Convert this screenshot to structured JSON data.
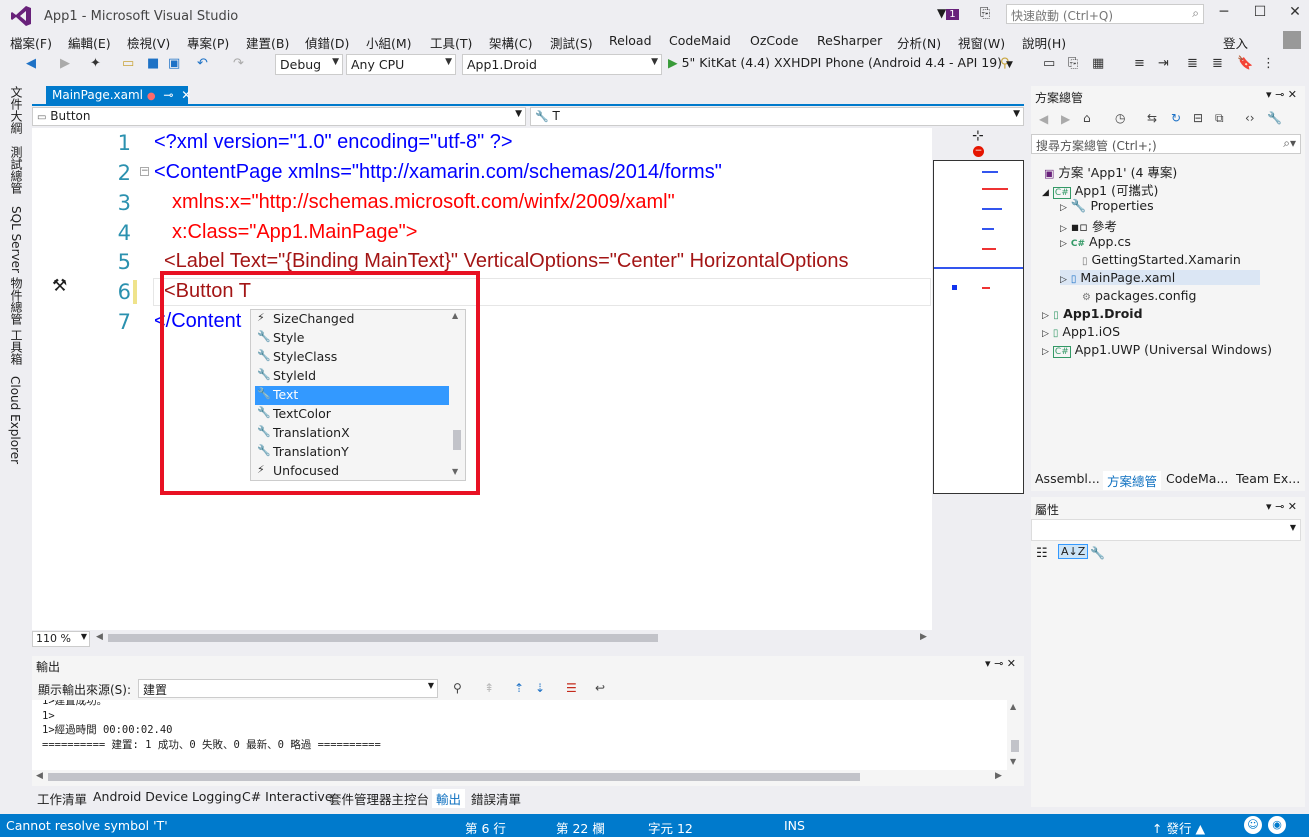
{
  "window": {
    "title": "App1 - Microsoft Visual Studio",
    "notification_count": "1",
    "quick_launch_placeholder": "快速啟動 (Ctrl+Q)",
    "accent": "#007acc"
  },
  "menu": [
    "檔案(F)",
    "編輯(E)",
    "檢視(V)",
    "專案(P)",
    "建置(B)",
    "偵錯(D)",
    "小組(M)",
    "工具(T)",
    "架構(C)",
    "測試(S)",
    "Reload",
    "CodeMaid",
    "OzCode",
    "ReSharper",
    "分析(N)",
    "視窗(W)",
    "說明(H)"
  ],
  "signin": "登入",
  "toolbar": {
    "config": "Debug",
    "platform": "Any CPU",
    "startup": "App1.Droid",
    "run_target": "5\" KitKat (4.4) XXHDPI Phone (Android 4.4 - API 19)"
  },
  "left_rail": [
    "文件大綱",
    "測試總管",
    "SQL Server 物件總管",
    "工具箱",
    "Cloud Explorer"
  ],
  "document_tab": {
    "name": "MainPage.xaml",
    "modified": "●",
    "pin": "⊸",
    "close": "✕"
  },
  "nav": {
    "left": "Button",
    "right": "T"
  },
  "code_lines": [
    {
      "num": "1",
      "text": "<?xml version=\"1.0\" encoding=\"utf-8\" ?>"
    },
    {
      "num": "2",
      "text": "<ContentPage xmlns=\"http://xamarin.com/schemas/2014/forms\""
    },
    {
      "num": "3",
      "text": "xmlns:x=\"http://schemas.microsoft.com/winfx/2009/xaml\""
    },
    {
      "num": "4",
      "text": "x:Class=\"App1.MainPage\">"
    },
    {
      "num": "5",
      "text": "<Label Text=\"{Binding MainText}\" VerticalOptions=\"Center\" HorizontalOptions"
    },
    {
      "num": "6",
      "text": "<Button T"
    },
    {
      "num": "7",
      "text": "</Content"
    }
  ],
  "intellisense": [
    {
      "label": "SizeChanged",
      "icon": "event-icon"
    },
    {
      "label": "Style",
      "icon": "property-icon"
    },
    {
      "label": "StyleClass",
      "icon": "property-icon"
    },
    {
      "label": "StyleId",
      "icon": "property-icon"
    },
    {
      "label": "Text",
      "icon": "property-icon",
      "selected": true
    },
    {
      "label": "TextColor",
      "icon": "property-icon"
    },
    {
      "label": "TranslationX",
      "icon": "property-icon"
    },
    {
      "label": "TranslationY",
      "icon": "property-icon"
    },
    {
      "label": "Unfocused",
      "icon": "event-icon"
    }
  ],
  "zoom": "110 %",
  "solution_explorer": {
    "title": "方案總管",
    "search_placeholder": "搜尋方案總管 (Ctrl+;)",
    "tree": [
      {
        "label": "方案 'App1' (4 專案)",
        "depth": 0,
        "icon": "solution-icon"
      },
      {
        "label": "App1 (可攜式)",
        "depth": 1,
        "icon": "csharp-project-icon",
        "expanded": true
      },
      {
        "label": "Properties",
        "depth": 2,
        "icon": "wrench-icon"
      },
      {
        "label": "參考",
        "depth": 2,
        "icon": "references-icon"
      },
      {
        "label": "App.cs",
        "depth": 2,
        "icon": "csharp-file-icon"
      },
      {
        "label": "GettingStarted.Xamarin",
        "depth": 2,
        "icon": "file-icon"
      },
      {
        "label": "MainPage.xaml",
        "depth": 2,
        "icon": "xaml-file-icon",
        "selected": true
      },
      {
        "label": "packages.config",
        "depth": 2,
        "icon": "config-file-icon"
      },
      {
        "label": "App1.Droid",
        "depth": 1,
        "icon": "android-project-icon",
        "bold": true
      },
      {
        "label": "App1.iOS",
        "depth": 1,
        "icon": "ios-project-icon"
      },
      {
        "label": "App1.UWP (Universal Windows)",
        "depth": 1,
        "icon": "csharp-project-icon"
      }
    ],
    "tabs": [
      "Assembl...",
      "方案總管",
      "CodeMa...",
      "Team Ex..."
    ]
  },
  "properties": {
    "title": "屬性"
  },
  "output": {
    "title": "輸出",
    "source_label": "顯示輸出來源(S):",
    "source_value": "建置",
    "lines": [
      "1>建置成功。",
      "1>",
      "1>經過時間 00:00:02.40",
      "========== 建置: 1 成功、0 失敗、0 最新、0 略過 =========="
    ]
  },
  "bottom_tabs": [
    "工作清單",
    "Android Device Logging",
    "C# Interactive",
    "套件管理器主控台",
    "輸出",
    "錯誤清單"
  ],
  "status": {
    "message": "Cannot resolve symbol 'T'",
    "line": "第 6 行",
    "col": "第 22 欄",
    "ch": "字元 12",
    "ins": "INS",
    "publish": "發行"
  }
}
